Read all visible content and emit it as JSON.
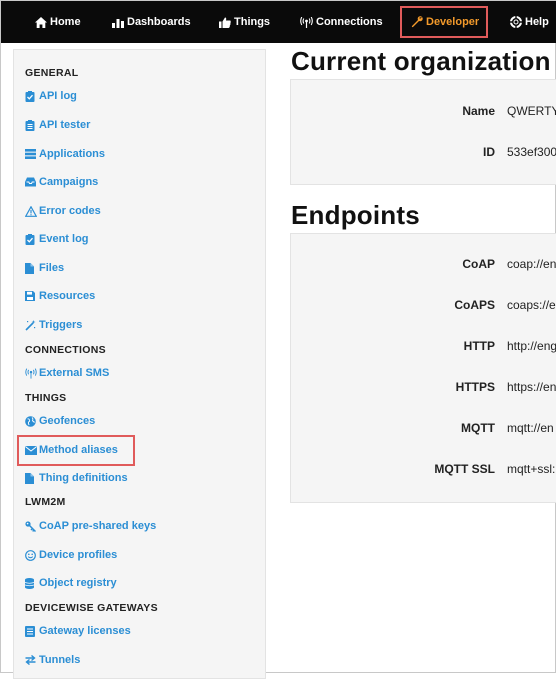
{
  "navbar": {
    "items": [
      {
        "label": "Home",
        "icon": "home-icon"
      },
      {
        "label": "Dashboards",
        "icon": "bar-chart-icon"
      },
      {
        "label": "Things",
        "icon": "thumbs-up-icon"
      },
      {
        "label": "Connections",
        "icon": "broadcast-icon"
      },
      {
        "label": "Developer",
        "icon": "wrench-icon",
        "active": true
      },
      {
        "label": "Help",
        "icon": "lifebuoy-icon"
      }
    ],
    "active_color": "#f39a2b",
    "highlight_color": "#e05b5b"
  },
  "sidebar": {
    "general": {
      "heading": "GENERAL",
      "items": [
        "API log",
        "API tester",
        "Applications",
        "Campaigns",
        "Error codes",
        "Event log",
        "Files",
        "Resources",
        "Triggers"
      ]
    },
    "connections": {
      "heading": "CONNECTIONS",
      "items": [
        "External SMS"
      ]
    },
    "things": {
      "heading": "THINGS",
      "items": [
        "Geofences",
        "Method aliases",
        "Thing definitions"
      ]
    },
    "lwm2m": {
      "heading": "LWM2M",
      "items": [
        "CoAP pre-shared keys",
        "Device profiles",
        "Object registry"
      ]
    },
    "gateways": {
      "heading": "DEVICEWISE GATEWAYS",
      "items": [
        "Gateway licenses",
        "Tunnels"
      ]
    },
    "link_color": "#2b8ed4"
  },
  "main": {
    "org_title": "Current organization",
    "org_rows": [
      {
        "label": "Name",
        "value": "QWERTY"
      },
      {
        "label": "ID",
        "value": "533ef300"
      }
    ],
    "endpoints_title": "Endpoints",
    "endpoint_rows": [
      {
        "label": "CoAP",
        "value": "coap://en"
      },
      {
        "label": "CoAPS",
        "value": "coaps://e"
      },
      {
        "label": "HTTP",
        "value": "http://eng"
      },
      {
        "label": "HTTPS",
        "value": "https://en"
      },
      {
        "label": "MQTT",
        "value": "mqtt://en"
      },
      {
        "label": "MQTT SSL",
        "value": "mqtt+ssl:"
      }
    ]
  }
}
